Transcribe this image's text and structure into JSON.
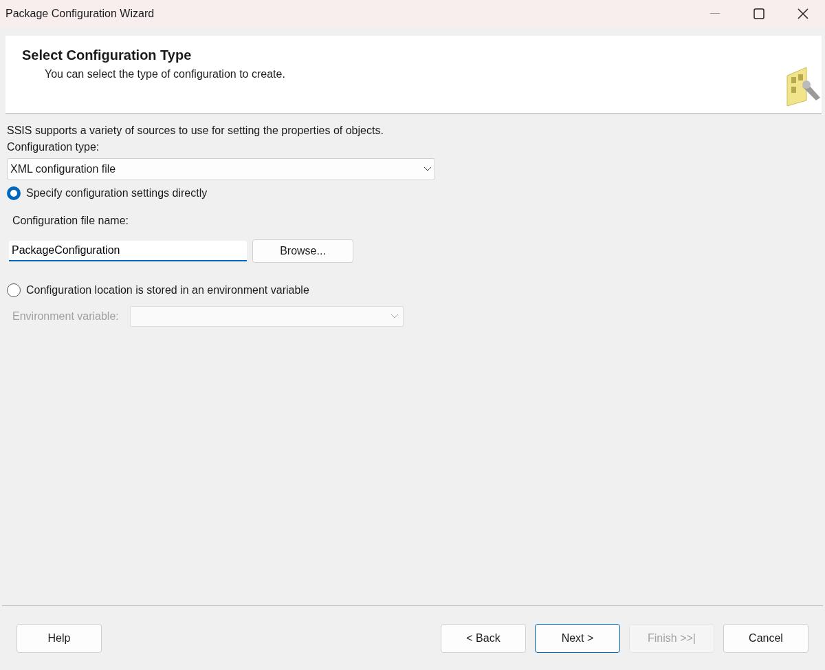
{
  "window": {
    "title": "Package Configuration Wizard"
  },
  "header": {
    "title": "Select Configuration Type",
    "subtitle": "You can select the type of configuration to create."
  },
  "intro": "SSIS supports a variety of sources to use for setting the properties of objects.",
  "configuration_type": {
    "label": "Configuration type:",
    "value": "XML configuration file"
  },
  "options": [
    {
      "label": "Specify configuration settings directly",
      "selected": true
    },
    {
      "label": "Configuration location is stored in an environment variable",
      "selected": false
    }
  ],
  "file_name": {
    "label": "Configuration file name:",
    "value": "PackageConfiguration",
    "browse": "Browse..."
  },
  "environment_variable": {
    "label": "Environment variable:",
    "disabled": true
  },
  "help_button": {
    "label": "Help"
  },
  "buttons": [
    {
      "label": "< Back",
      "default": false,
      "disabled": false
    },
    {
      "label": "Next >",
      "default": true,
      "disabled": false
    },
    {
      "label": "Finish >>|",
      "default": false,
      "disabled": true
    },
    {
      "label": "Cancel",
      "default": false,
      "disabled": false
    }
  ]
}
